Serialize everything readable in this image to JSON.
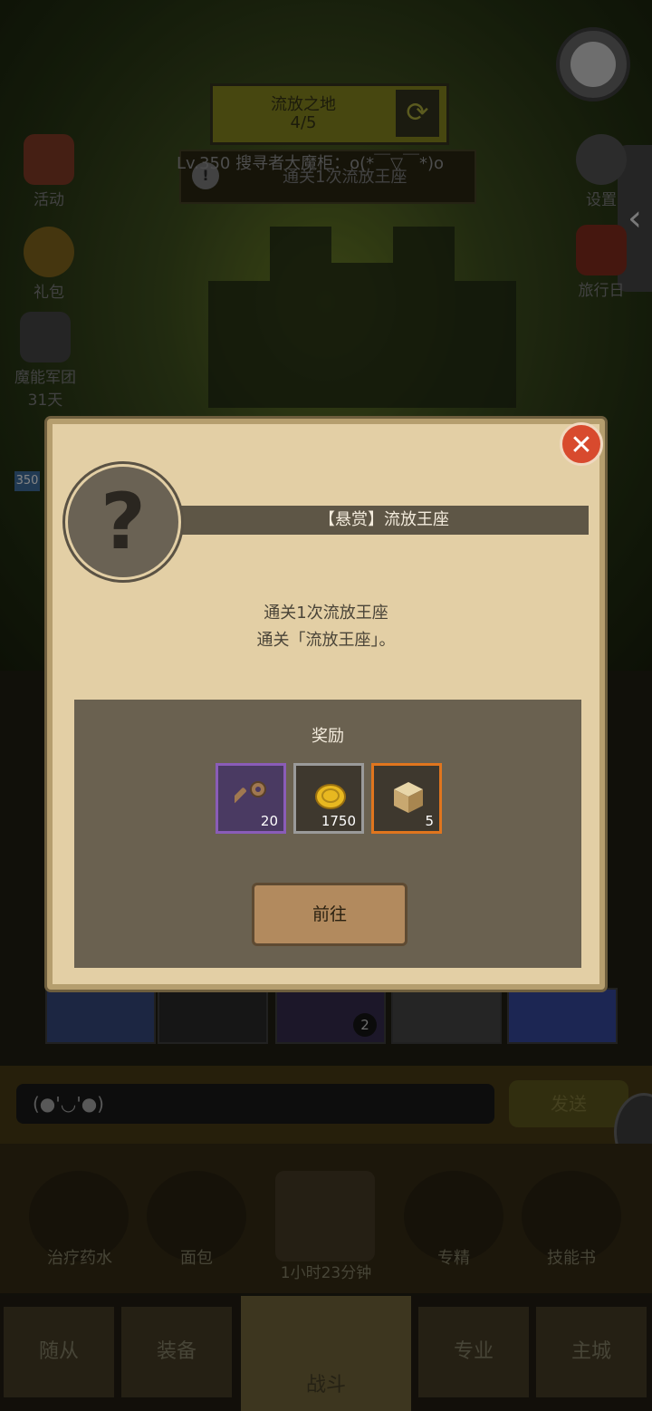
{
  "top": {
    "stage_name": "流放之地",
    "stage_progress": "4/5",
    "player_line": "Lv.350 搜寻者大魔柜：o(*￣▽￣*)o",
    "quest_text": "通关1次流放王座"
  },
  "side_left": [
    {
      "label": "活动"
    },
    {
      "label": "礼包"
    },
    {
      "label": "魔能军团",
      "sub": "31天"
    }
  ],
  "side_right": [
    {
      "label": "设置"
    },
    {
      "label": "旅行日"
    }
  ],
  "modal": {
    "title": "【悬赏】流放王座",
    "badge": "?",
    "desc_line1": "通关1次流放王座",
    "desc_line2": "通关「流放王座」。",
    "reward_title": "奖励",
    "rewards": [
      {
        "icon": "key-icon",
        "count": "20",
        "border": "#8a5cb8"
      },
      {
        "icon": "gold-coin-icon",
        "count": "1750",
        "border": "#9a9a9a"
      },
      {
        "icon": "cube-icon",
        "count": "5",
        "border": "#e0751e"
      }
    ],
    "go_label": "前往",
    "close_symbol": "✕"
  },
  "chat": {
    "input_text": "(●'◡'●)",
    "send_label": "发送"
  },
  "items": [
    {
      "label": "治疗药水"
    },
    {
      "label": "面包"
    },
    {
      "label": ""
    },
    {
      "label": "专精"
    },
    {
      "label": "技能书"
    }
  ],
  "timer": "1小时23分钟",
  "nav": {
    "tab1": "随从",
    "tab2": "装备",
    "tab3": "战斗",
    "tab4": "专业",
    "tab5": "主城"
  },
  "misc": {
    "level_tag": "350",
    "slot_badge": "2"
  }
}
